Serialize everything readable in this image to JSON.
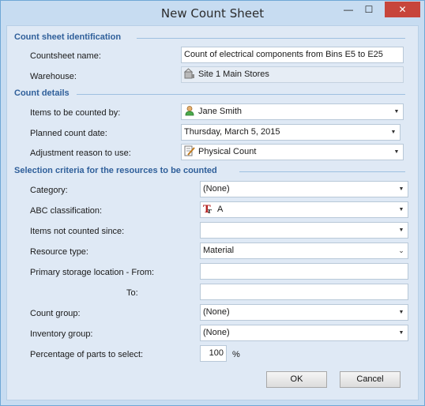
{
  "window": {
    "title": "New Count Sheet"
  },
  "controls": {
    "minimize": "—",
    "maximize": "☐",
    "close": "✕"
  },
  "sections": {
    "identification": "Count sheet identification",
    "details": "Count details",
    "criteria": "Selection criteria for the resources to be counted"
  },
  "identification": {
    "name_label": "Countsheet name:",
    "name_value": "Count of electrical components from Bins E5 to  E25",
    "warehouse_label": "Warehouse:",
    "warehouse_value": "Site 1 Main Stores",
    "warehouse_icon": "warehouse-icon"
  },
  "details": {
    "counter_label": "Items to be counted by:",
    "counter_value": "Jane Smith",
    "counter_icon": "person-icon",
    "date_label": "Planned count date:",
    "date_value": "Thursday, March 5, 2015",
    "reason_label": "Adjustment reason to use:",
    "reason_value": "Physical Count",
    "reason_icon": "document-pencil-icon"
  },
  "criteria": {
    "category_label": "Category:",
    "category_value": "(None)",
    "abc_label": "ABC classification:",
    "abc_value": "A",
    "abc_icon": "abc-class-icon",
    "not_counted_label": "Items not counted since:",
    "not_counted_value": "",
    "resource_type_label": "Resource type:",
    "resource_type_value": "Material",
    "storage_from_label": "Primary storage location - From:",
    "storage_from_value": "",
    "storage_to_label": "To:",
    "storage_to_value": "",
    "count_group_label": "Count group:",
    "count_group_value": "(None)",
    "inventory_group_label": "Inventory group:",
    "inventory_group_value": "(None)",
    "percentage_label": "Percentage of parts to select:",
    "percentage_value": "100",
    "percentage_unit": "%"
  },
  "buttons": {
    "ok": "OK",
    "cancel": "Cancel"
  }
}
